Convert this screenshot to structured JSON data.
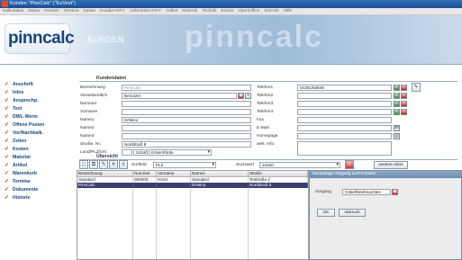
{
  "window": {
    "title": "Kunden \"PinnCalc\" (\"EuVest\")"
  },
  "menu": [
    "Kalkulation",
    "Daten",
    "Fenster",
    "Termine",
    "Kasse",
    "Kunden-DFV",
    "Lieferanten-DFV",
    "Artikel",
    "Material",
    "Technik",
    "Extras",
    "OpenOffice",
    "Internet",
    "Hilfe"
  ],
  "brand": {
    "logo_main": "pinncalc",
    "module": "KUNDEN",
    "watermark": "pinncalc"
  },
  "sidebar": {
    "items": [
      "Anschrift",
      "Infos",
      "Ansprechp.",
      "Text",
      "DWL-Werte",
      "Offene Posten",
      "Vor/Nachkalk.",
      "Zeiten",
      "Kosten",
      "Material",
      "Artikel",
      "Warenkorb",
      "Termine",
      "Dokumente",
      "Historie"
    ]
  },
  "form": {
    "section_title": "Kundendaten",
    "left_fields": [
      {
        "label": "Bezeichnung",
        "value": "PinnCalc",
        "ghost": true
      },
      {
        "label": "Verantwortlich",
        "value": "Benutzer",
        "ghost": false
      },
      {
        "label": "Nummer",
        "value": "",
        "ghost": false
      },
      {
        "label": "Vorname",
        "value": "",
        "ghost": false
      },
      {
        "label": "Name1",
        "value": "DrWino",
        "ghost": false
      },
      {
        "label": "Name2",
        "value": "",
        "ghost": false
      },
      {
        "label": "Name3",
        "value": "",
        "ghost": false
      },
      {
        "label": "Straße, Nr.",
        "value": "Nordstraß 8",
        "ghost": false
      }
    ],
    "land_plz_label": "Land/PLZ/Ort",
    "land_value": "",
    "plz_value": "24340",
    "ort_value": "Eckernförde",
    "right_fields": [
      {
        "label": "Telefon1",
        "value": "04351/56849"
      },
      {
        "label": "Telefon2",
        "value": ""
      },
      {
        "label": "Telefon3",
        "value": ""
      },
      {
        "label": "Telefon4",
        "value": ""
      },
      {
        "label": "Fax",
        "value": ""
      },
      {
        "label": "E-Mail",
        "value": ""
      },
      {
        "label": "Homepage",
        "value": ""
      },
      {
        "label": "weit. Info",
        "value": ""
      }
    ]
  },
  "overview": {
    "section_title": "Übersicht",
    "sortfeld_label": "Sortfeld",
    "sortfeld_value": "PLZ",
    "suchwert_label": "Suchwert",
    "suchwert_value": "24340",
    "weitere_label": "weitere Infos",
    "columns": [
      "Bezeichnung",
      "Nummer",
      "Vorname",
      "Name1",
      "Straße"
    ],
    "rows": [
      [
        "Standard",
        "000003",
        "Horst",
        "Standard",
        "Testtraße 2"
      ],
      [
        "PinnCalc",
        "",
        "",
        "DrWino",
        "Nordstraß 8"
      ]
    ]
  },
  "dialog": {
    "title": "Neuanlage Vorgang zum Kunden",
    "field_label": "Vorgang",
    "field_value": "3-Bief/Weihnachten",
    "ok_label": "OK",
    "cancel_label": "Abbruch"
  }
}
